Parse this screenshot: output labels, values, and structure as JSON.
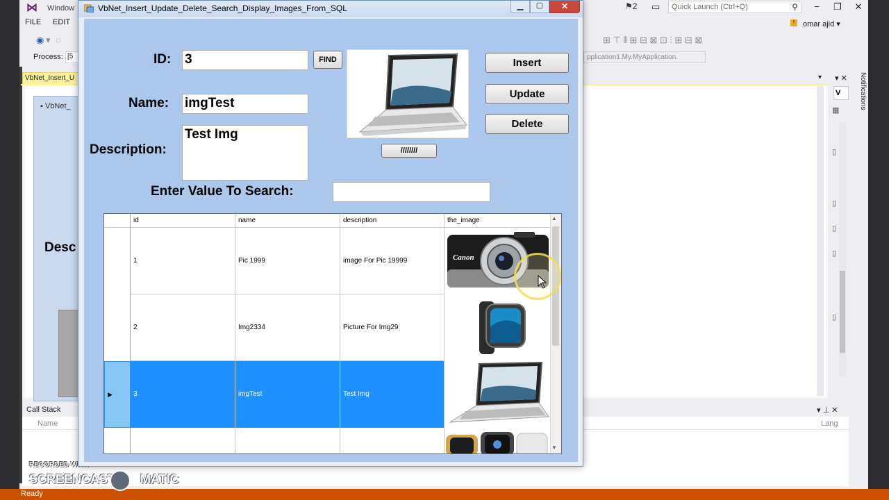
{
  "vs": {
    "window_title": "Window",
    "menu": [
      "FILE",
      "EDIT"
    ],
    "quick_launch_placeholder": "Quick Launch (Ctrl+Q)",
    "notification_count": "2",
    "user_name": "omar ajid",
    "process_label": "Process:",
    "process_value": "[5",
    "app_dropdown": "pplication1.My.MyApplication.",
    "doc_tab": "VbNet_Insert_U",
    "inner_form_title": "VbNet_",
    "inner_desc_label": "Desc",
    "right_tab": "V",
    "notifications_label": "Notifications",
    "callstack_title": "Call Stack",
    "callstack_col_name": "Name",
    "callstack_col_lang": "Lang",
    "status": "Ready"
  },
  "watermark": {
    "line1": "RECORDED WITH",
    "line2": "SCREENCAST",
    "line3": "MATIC"
  },
  "app": {
    "title": "VbNet_Insert_Update_Delete_Search_Display_Images_From_SQL",
    "id_label": "ID:",
    "id_value": "3",
    "find_button": "FIND",
    "name_label": "Name:",
    "name_value": "imgTest",
    "description_label": "Description:",
    "description_value": "Test Img",
    "search_label": "Enter Value To Search:",
    "search_value": "",
    "browse_button": "////////",
    "insert_button": "Insert",
    "update_button": "Update",
    "delete_button": "Delete",
    "image_preview": "laptop",
    "grid": {
      "columns": [
        "id",
        "name",
        "description",
        "the_image"
      ],
      "rows": [
        {
          "id": "1",
          "name": "Pic 1999",
          "description": "image For Pic 19999",
          "image": "canon-camera",
          "camera_brand": "Canon"
        },
        {
          "id": "2",
          "name": "Img2334",
          "description": "Picture For Img29",
          "image": "smartwatch"
        },
        {
          "id": "3",
          "name": "imgTest",
          "description": "Test Img",
          "image": "laptop",
          "selected": true
        },
        {
          "id": "",
          "name": "",
          "description": "",
          "image": "watches"
        }
      ]
    }
  },
  "colors": {
    "selection": "#1e90ff",
    "form_bg": "#abc7ec",
    "status_bar": "#ca5100"
  }
}
